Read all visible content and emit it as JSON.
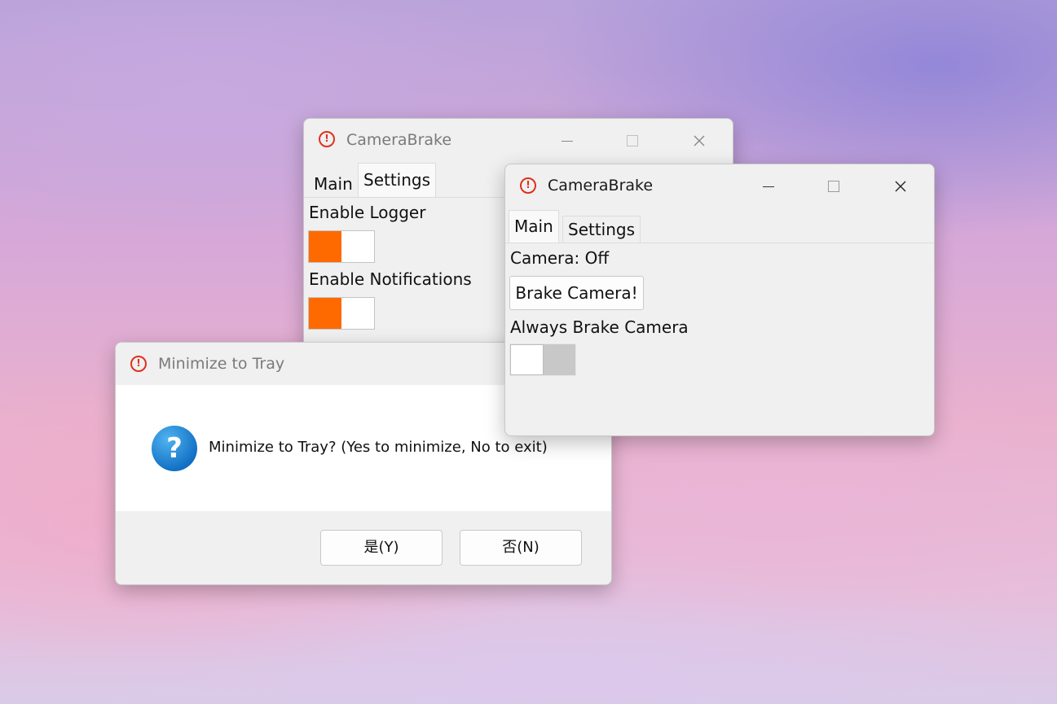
{
  "settings_window": {
    "title": "CameraBrake",
    "tabs": [
      "Main",
      "Settings"
    ],
    "selected_tab": "Settings",
    "enable_logger_label": "Enable Logger",
    "enable_logger_on": true,
    "enable_notifications_label": "Enable Notifications",
    "enable_notifications_on": true
  },
  "main_window": {
    "title": "CameraBrake",
    "tabs": [
      "Main",
      "Settings"
    ],
    "selected_tab": "Main",
    "camera_status": "Camera: Off",
    "brake_button": "Brake Camera!",
    "always_brake_label": "Always Brake Camera",
    "always_brake_on": false
  },
  "dialog": {
    "title": "Minimize to Tray",
    "message": "Minimize to Tray? (Yes to minimize, No to exit)",
    "yes_button": "是(Y)",
    "no_button": "否(N)"
  },
  "icons": {
    "app": "brake-warning-icon",
    "question": "question-icon",
    "minimize": "minimize-icon",
    "maximize": "maximize-icon",
    "close": "close-icon"
  },
  "colors": {
    "toggle_on": "#ff6a00",
    "toggle_off": "#c8c8c8",
    "app_icon": "#e0301e",
    "question_icon": "#1472c6"
  }
}
